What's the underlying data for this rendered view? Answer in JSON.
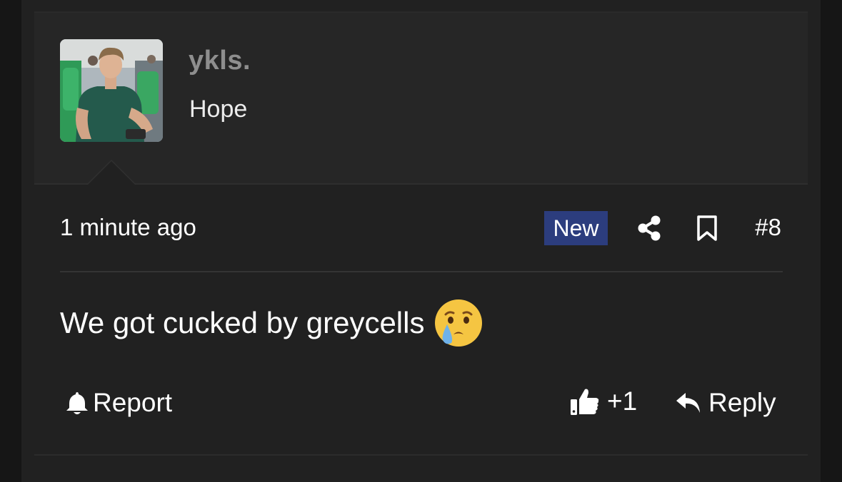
{
  "user": {
    "name": "ykls.",
    "title": "Hope"
  },
  "post": {
    "time": "1 minute ago",
    "badge": "New",
    "number": "#8",
    "message": "We got cucked by greycells",
    "emoji": "crying-face"
  },
  "actions": {
    "report_label": "Report",
    "like_count": "+1",
    "reply_label": "Reply"
  },
  "icons": {
    "share": "share-icon",
    "bookmark": "bookmark-icon",
    "bell": "bell-icon",
    "like": "thumbs-up-icon",
    "reply": "reply-arrow-icon"
  },
  "colors": {
    "background": "#212121",
    "header_background": "#262626",
    "badge_background": "#2c3d7e",
    "username": "#8e8e8e",
    "text": "#ffffff"
  }
}
